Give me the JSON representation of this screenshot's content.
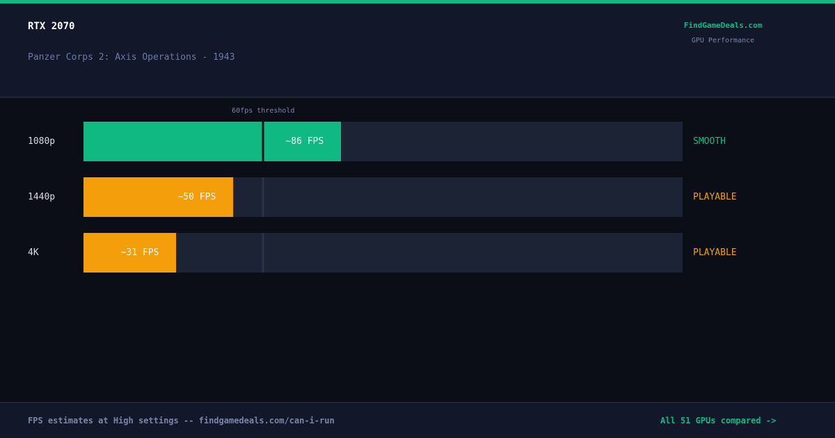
{
  "header": {
    "gpu": "RTX 2070",
    "game": "Panzer Corps 2: Axis Operations - 1943",
    "brand": "FindGameDeals.com",
    "brand_sub": "GPU Performance"
  },
  "chart_data": {
    "type": "bar",
    "orientation": "horizontal",
    "categories": [
      "1080p",
      "1440p",
      "4K"
    ],
    "values": [
      86,
      50,
      31
    ],
    "value_labels": [
      "~86 FPS",
      "~50 FPS",
      "~31 FPS"
    ],
    "status": [
      "SMOOTH",
      "PLAYABLE",
      "PLAYABLE"
    ],
    "status_colors": [
      "#10b981",
      "#f59e0b",
      "#f59e0b"
    ],
    "xlim": [
      0,
      200
    ],
    "threshold": {
      "value": 60,
      "label": "60fps threshold"
    },
    "grid": false
  },
  "footer": {
    "note": "FPS estimates at High settings -- findgamedeals.com/can-i-run",
    "link": "All 51 GPUs compared ->"
  },
  "colors": {
    "accent": "#10b981",
    "warning": "#f59e0b",
    "background": "#0b0e17",
    "panel": "#121829",
    "track": "#1b2335"
  }
}
